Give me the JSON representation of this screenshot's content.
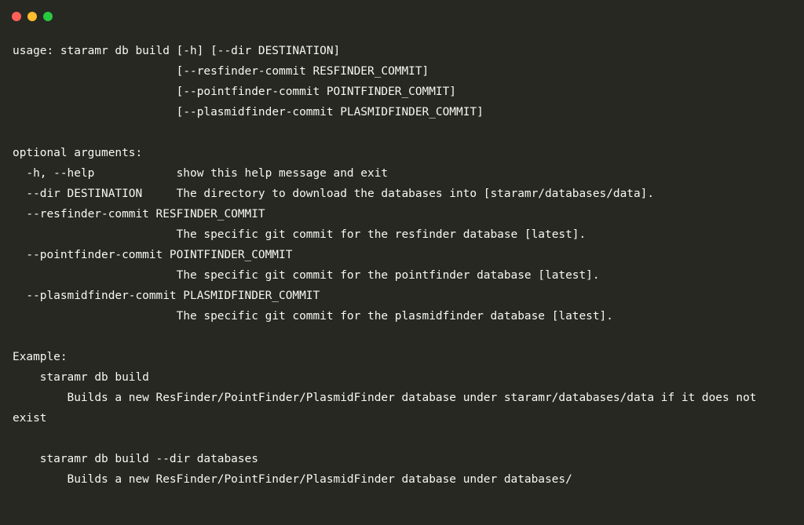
{
  "window": {
    "controls": [
      {
        "name": "close",
        "color": "#ff5f56"
      },
      {
        "name": "minimize",
        "color": "#ffbd2e"
      },
      {
        "name": "maximize",
        "color": "#27c93f"
      }
    ],
    "background": "#272822",
    "text_color": "#f8f8f2"
  },
  "terminal": {
    "lines": [
      "usage: staramr db build [-h] [--dir DESTINATION]",
      "                        [--resfinder-commit RESFINDER_COMMIT]",
      "                        [--pointfinder-commit POINTFINDER_COMMIT]",
      "                        [--plasmidfinder-commit PLASMIDFINDER_COMMIT]",
      "",
      "optional arguments:",
      "  -h, --help            show this help message and exit",
      "  --dir DESTINATION     The directory to download the databases into [staramr/databases/data].",
      "  --resfinder-commit RESFINDER_COMMIT",
      "                        The specific git commit for the resfinder database [latest].",
      "  --pointfinder-commit POINTFINDER_COMMIT",
      "                        The specific git commit for the pointfinder database [latest].",
      "  --plasmidfinder-commit PLASMIDFINDER_COMMIT",
      "                        The specific git commit for the plasmidfinder database [latest].",
      "",
      "Example:",
      "    staramr db build",
      "        Builds a new ResFinder/PointFinder/PlasmidFinder database under staramr/databases/data if it does not exist",
      "",
      "    staramr db build --dir databases",
      "        Builds a new ResFinder/PointFinder/PlasmidFinder database under databases/"
    ]
  }
}
